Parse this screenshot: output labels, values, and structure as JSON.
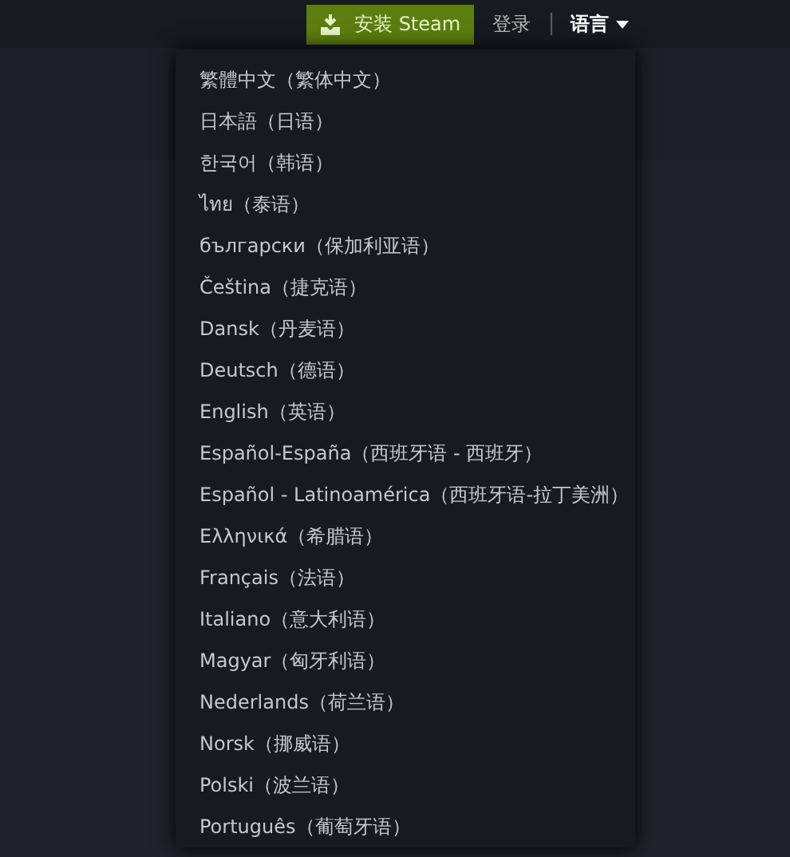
{
  "header": {
    "install_button": "安装 Steam",
    "login_link": "登录",
    "language_menu": {
      "label": "语言",
      "expanded": true
    }
  },
  "language_dropdown": {
    "items": [
      {
        "label": "繁體中文（繁体中文）"
      },
      {
        "label": "日本語（日语）"
      },
      {
        "label": "한국어（韩语）"
      },
      {
        "label": "ไทย（泰语）"
      },
      {
        "label": "български（保加利亚语）"
      },
      {
        "label": "Čeština（捷克语）"
      },
      {
        "label": "Dansk（丹麦语）"
      },
      {
        "label": "Deutsch（德语）"
      },
      {
        "label": "English（英语）"
      },
      {
        "label": "Español-España（西班牙语 - 西班牙）"
      },
      {
        "label": "Español - Latinoamérica（西班牙语-拉丁美洲）"
      },
      {
        "label": "Ελληνικά（希腊语）"
      },
      {
        "label": "Français（法语）"
      },
      {
        "label": "Italiano（意大利语）"
      },
      {
        "label": "Magyar（匈牙利语）"
      },
      {
        "label": "Nederlands（荷兰语）"
      },
      {
        "label": "Norsk（挪威语）"
      },
      {
        "label": "Polski（波兰语）"
      },
      {
        "label": "Português（葡萄牙语）"
      }
    ]
  }
}
